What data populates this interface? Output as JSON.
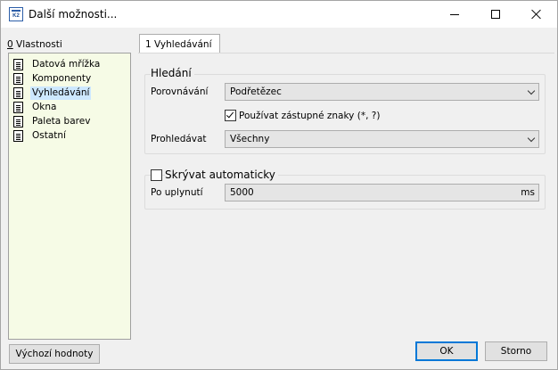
{
  "window": {
    "title": "Další možnosti...",
    "icon_name": "k2-app-icon",
    "icon_text": "K2"
  },
  "left": {
    "label_prefix": "0",
    "label_rest": " Vlastnosti",
    "items": [
      {
        "label": "Datová mřížka",
        "icon": "document-icon",
        "selected": false
      },
      {
        "label": "Komponenty",
        "icon": "document-icon",
        "selected": false
      },
      {
        "label": "Vyhledávání",
        "icon": "document-icon",
        "selected": true
      },
      {
        "label": "Okna",
        "icon": "document-icon",
        "selected": false
      },
      {
        "label": "Paleta barev",
        "icon": "document-icon",
        "selected": false
      },
      {
        "label": "Ostatní",
        "icon": "document-icon",
        "selected": false
      }
    ],
    "tree_bg": "#f6fbe6",
    "selected_bg": "#cde8ff"
  },
  "tab": {
    "label": "1 Vyhledávání"
  },
  "search_group": {
    "title": "Hledání",
    "compare_label": "Porovnávání",
    "compare_value": "Podřetězec",
    "wildcards_label": "Používat zástupné znaky (*, ?)",
    "wildcards_checked": true,
    "search_in_label": "Prohledávat",
    "search_in_value": "Všechny"
  },
  "autohide_group": {
    "title": "Skrývat automaticky",
    "checked": false,
    "after_label": "Po uplynutí",
    "after_value": "5000",
    "after_unit": "ms"
  },
  "buttons": {
    "defaults": "Výchozí hodnoty",
    "ok": "OK",
    "cancel": "Storno"
  },
  "colors": {
    "accent": "#0078d7",
    "window_bg": "#f0f0f0"
  }
}
